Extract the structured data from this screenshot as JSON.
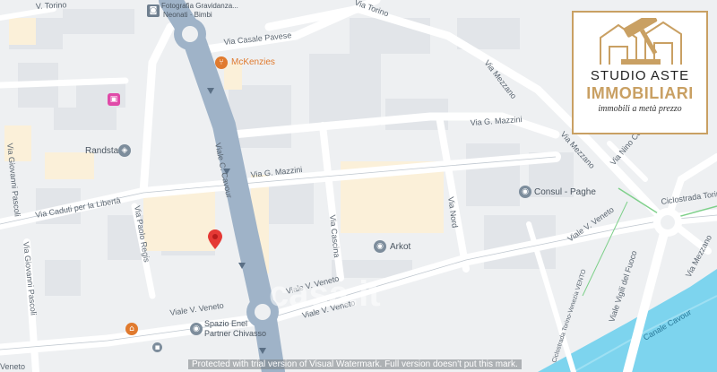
{
  "map": {
    "streets": {
      "viale_c_cavour": "Viale C. Cavour",
      "via_g_mazzini_1": "Via G. Mazzini",
      "via_g_mazzini_2": "Via G. Mazzini",
      "via_caduti": "Via Caduti per la Libertà",
      "via_paolo_regis": "Via Paolo Regis",
      "via_casale_pavese": "Via Casale Pavese",
      "via_torino": "V. Torino",
      "via_giovanni_pascoli": "Via Giovanni Pascoli",
      "via_giovanni_pascoli_2": "Via Giovanni Pascoli",
      "viale_v_veneto_1": "Viale V. Veneto",
      "viale_v_veneto_2": "Viale V. Veneto",
      "viale_v_veneto_3": "Viale V. Veneto",
      "viale_v_veneto_4": "Viale V. Veneto",
      "viale_v_veneto_5": "Viale V. Veneto",
      "via_mezzano_1": "Via Mezzano",
      "via_mezzano_2": "Via Mezzano",
      "via_mezzano_3": "Via Mezzano",
      "via_nino_costa": "Via Nino Costa",
      "via_del_fuoco": "Viale Vigili del Fuoco",
      "ciclostrada": "Ciclostrada Torino - Venezia",
      "ciclostrada_2": "Ciclostrada Torino-Venezia VENTO",
      "via_cascina": "Via Cascina",
      "via_nord": "Via Nord",
      "via_torino_v": "Via Torino",
      "canale_cavour": "Canale Cavour",
      "veneto_bottom": "Veneto"
    },
    "pois": {
      "photo": "Fotografia Gravidanza...",
      "photo2": "Neonati · Bimbi",
      "mckenzies": "McKenzies",
      "randstad": "Randstad",
      "consul": "Consul - Paghe",
      "arkot": "Arkot",
      "spazio1": "Spazio Enel",
      "spazio2": "Partner Chivasso"
    },
    "logo": {
      "line1": "STUDIO ASTE",
      "line2": "IMMOBILIARI",
      "line3": "immobili a metà prezzo"
    },
    "watermark": "casa.it",
    "footer": "Protected with trial version of Visual Watermark. Full version doesn't put this mark."
  }
}
